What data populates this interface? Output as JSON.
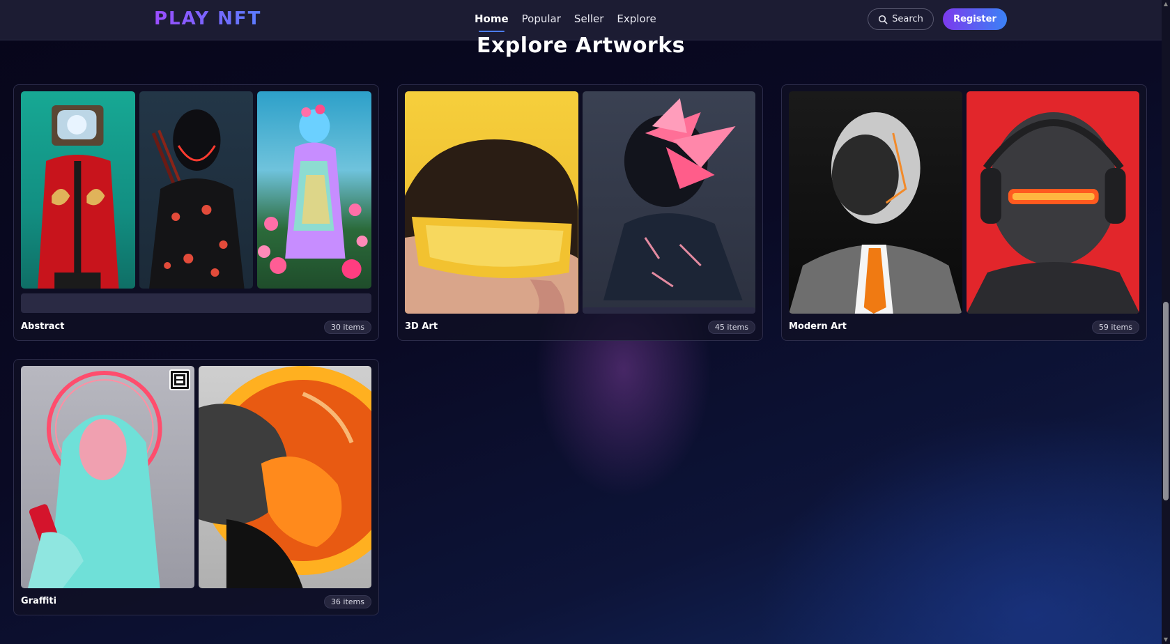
{
  "nav": {
    "logo": "PLAY NFT",
    "links": [
      "Home",
      "Popular",
      "Seller",
      "Explore"
    ],
    "active_link": "Home",
    "search_label": "Search",
    "register_label": "Register"
  },
  "section": {
    "title": "Explore Artworks"
  },
  "collections": [
    {
      "name": "Abstract",
      "count": "30 items"
    },
    {
      "name": "3D Art",
      "count": "45 items"
    },
    {
      "name": "Modern Art",
      "count": "59 items"
    },
    {
      "name": "Graffiti",
      "count": "36 items"
    }
  ],
  "colors": {
    "accent_purple": "#7c3aed",
    "accent_blue": "#3b82f6",
    "nav_bg": "#1c1c33",
    "page_bg": "#07061a"
  }
}
